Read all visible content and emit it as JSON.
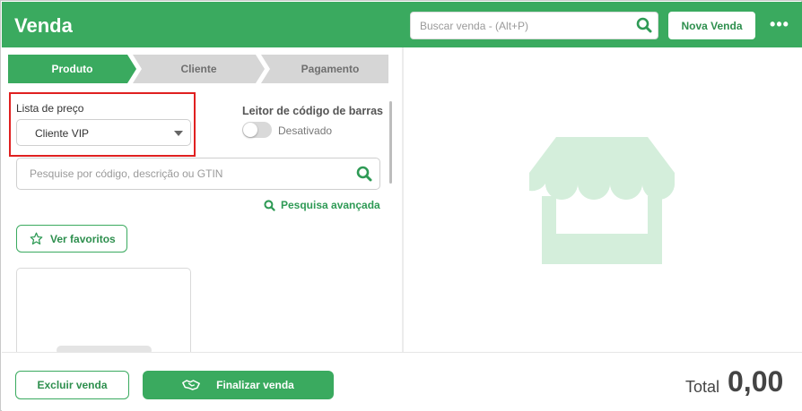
{
  "header": {
    "title": "Venda",
    "search_placeholder": "Buscar venda - (Alt+P)",
    "new_sale_label": "Nova Venda",
    "more_label": "•••"
  },
  "steps": [
    {
      "label": "Produto",
      "active": true
    },
    {
      "label": "Cliente",
      "active": false
    },
    {
      "label": "Pagamento",
      "active": false
    }
  ],
  "price_list": {
    "label": "Lista de preço",
    "value": "Cliente VIP"
  },
  "barcode": {
    "label": "Leitor de código de barras",
    "state_label": "Desativado",
    "enabled": false
  },
  "product_search": {
    "placeholder": "Pesquise por código, descrição ou GTIN",
    "advanced_label": "Pesquisa avançada"
  },
  "favorites_label": "Ver favoritos",
  "footer": {
    "delete_label": "Excluir venda",
    "finish_label": "Finalizar venda",
    "total_label": "Total",
    "total_value": "0,00"
  },
  "colors": {
    "brand_green": "#3aaa5f",
    "highlight_red": "#e02020",
    "store_icon": "#d4eedb"
  },
  "icons": [
    "search-icon",
    "more-icon",
    "star-icon",
    "handshake-icon",
    "store-icon"
  ]
}
